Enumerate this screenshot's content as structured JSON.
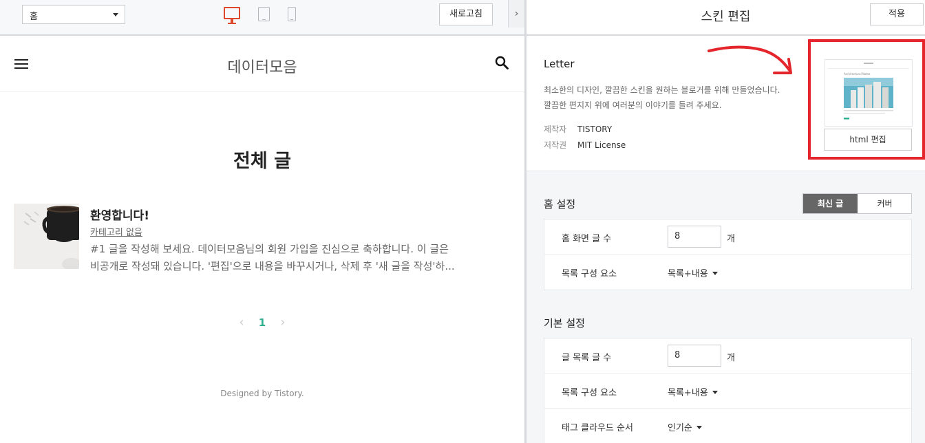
{
  "toolbar": {
    "page_select_value": "홈",
    "device_icons": [
      "desktop-icon",
      "tablet-icon",
      "mobile-icon"
    ],
    "refresh_label": "새로고침",
    "collapse_glyph": "›",
    "active_color": "#e0482e"
  },
  "blog": {
    "title": "데이터모음",
    "section_title": "전체 글",
    "post": {
      "title": "환영합니다!",
      "category": "카테고리 없음",
      "excerpt_line1": "#1 글을 작성해 보세요. 데이터모음님의 회원 가입을 진심으로 축하합니다. 이 글은",
      "excerpt_line2": "비공개로 작성돼 있습니다. '편집'으로 내용을 바꾸시거나, 삭제 후 '새 글을 작성'하..."
    },
    "pagination": {
      "prev": "‹",
      "current": "1",
      "next": "›"
    },
    "footer": "Designed by Tistory.",
    "accent_color": "#2baf8f"
  },
  "editor": {
    "title": "스킨 편집",
    "apply_label": "적용",
    "skin": {
      "name": "Letter",
      "desc_line1": "최소한의 디자인, 깔끔한 스킨을 원하는 블로거를 위해 만들었습니다.",
      "desc_line2": "깔끔한 편지지 위에 여러분의 이야기를 들려 주세요.",
      "maker_key": "제작자",
      "maker_value": "TISTORY",
      "license_key": "저작권",
      "license_value": "MIT License",
      "html_edit_label": "html 편집",
      "thumb_caption": "Architectural Notes",
      "highlight_color": "#e4262c"
    },
    "home_settings": {
      "label": "홈 설정",
      "toggle_on": "최신 글",
      "toggle_off": "커버",
      "rows": [
        {
          "label": "홈 화면 글 수",
          "value": "8",
          "unit": "개"
        },
        {
          "label": "목록 구성 요소",
          "value": "목록+내용"
        }
      ]
    },
    "basic_settings": {
      "label": "기본 설정",
      "rows": [
        {
          "label": "글 목록 글 수",
          "value": "8",
          "unit": "개"
        },
        {
          "label": "목록 구성 요소",
          "value": "목록+내용"
        },
        {
          "label": "태그 클라우드 순서",
          "value": "인기순"
        }
      ]
    }
  }
}
